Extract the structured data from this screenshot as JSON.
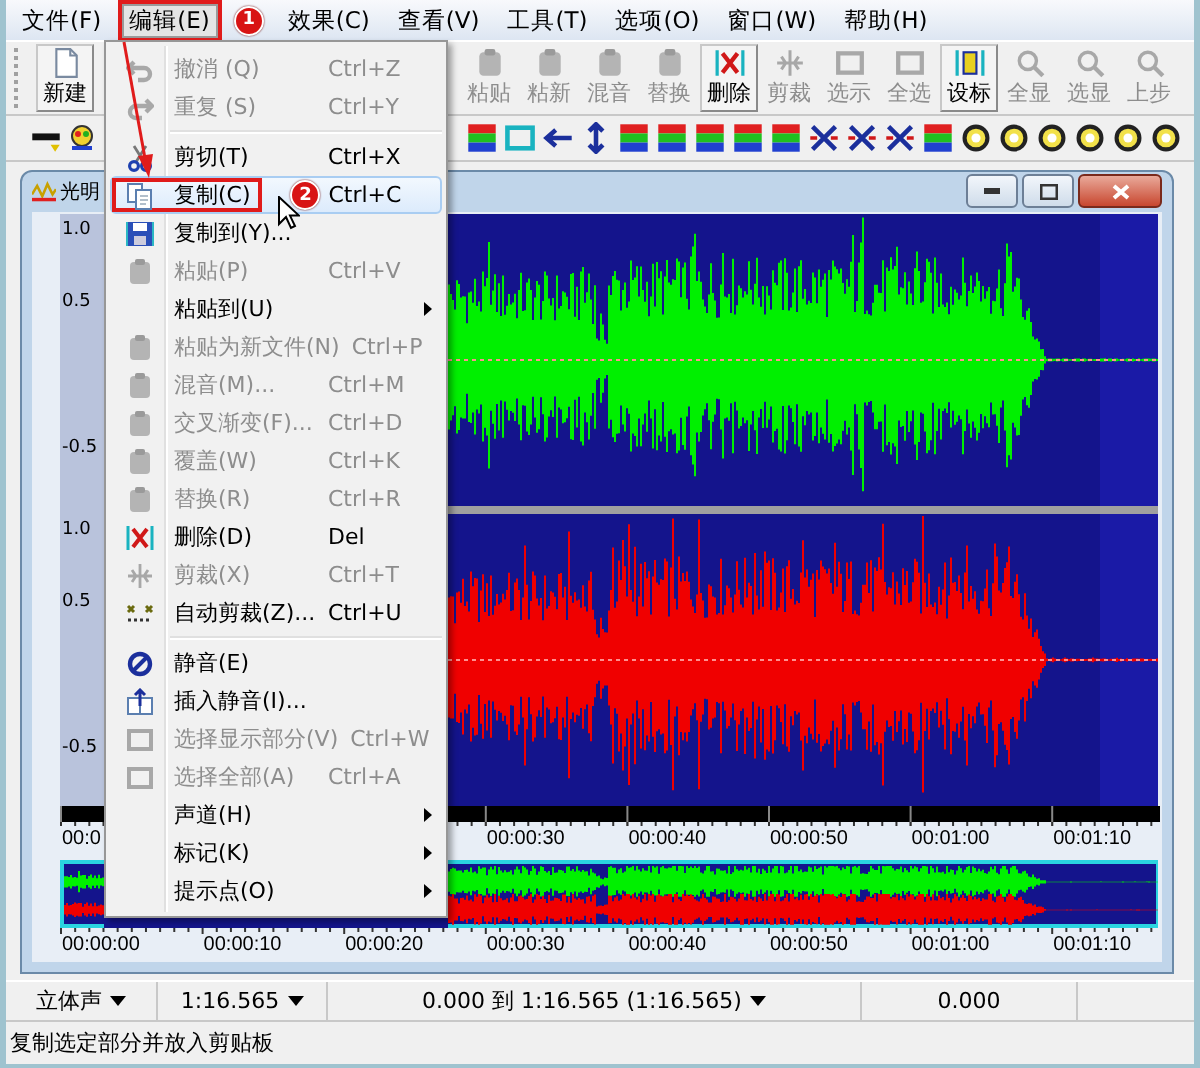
{
  "menu_bar": [
    {
      "label": "文件(F)",
      "selected": false
    },
    {
      "label": "编辑(E)",
      "selected": true,
      "callout": "1"
    },
    {
      "label": "效果(C)",
      "selected": false
    },
    {
      "label": "查看(V)",
      "selected": false
    },
    {
      "label": "工具(T)",
      "selected": false
    },
    {
      "label": "选项(O)",
      "selected": false
    },
    {
      "label": "窗口(W)",
      "selected": false
    },
    {
      "label": "帮助(H)",
      "selected": false
    }
  ],
  "toolbar": [
    {
      "label": "新建",
      "disabled": false
    },
    {
      "label": "粘贴",
      "disabled": true
    },
    {
      "label": "粘新",
      "disabled": true
    },
    {
      "label": "混音",
      "disabled": true
    },
    {
      "label": "替换",
      "disabled": true
    },
    {
      "label": "删除",
      "disabled": false
    },
    {
      "label": "剪裁",
      "disabled": true
    },
    {
      "label": "选示",
      "disabled": true
    },
    {
      "label": "全选",
      "disabled": true
    },
    {
      "label": "设标",
      "disabled": false
    },
    {
      "label": "全显",
      "disabled": true
    },
    {
      "label": "选显",
      "disabled": true
    },
    {
      "label": "上步",
      "disabled": true
    }
  ],
  "edit_menu": {
    "items": [
      {
        "kind": "item",
        "label": "撤消 (Q)",
        "shortcut": "Ctrl+Z",
        "disabled": true,
        "selected": false,
        "submenu": false
      },
      {
        "kind": "item",
        "label": "重复 (S)",
        "shortcut": "Ctrl+Y",
        "disabled": true,
        "selected": false,
        "submenu": false
      },
      {
        "kind": "separator"
      },
      {
        "kind": "item",
        "label": "剪切(T)",
        "shortcut": "Ctrl+X",
        "disabled": false,
        "selected": false,
        "submenu": false
      },
      {
        "kind": "item",
        "label": "复制(C)",
        "shortcut": "Ctrl+C",
        "disabled": false,
        "selected": true,
        "submenu": false,
        "callout": "2"
      },
      {
        "kind": "item",
        "label": "复制到(Y)...",
        "disabled": false,
        "selected": false,
        "submenu": false
      },
      {
        "kind": "item",
        "label": "粘贴(P)",
        "shortcut": "Ctrl+V",
        "disabled": true,
        "selected": false,
        "submenu": false
      },
      {
        "kind": "item",
        "label": "粘贴到(U)",
        "disabled": false,
        "selected": false,
        "submenu": true
      },
      {
        "kind": "item",
        "label": "粘贴为新文件(N)",
        "shortcut": "Ctrl+P",
        "disabled": true,
        "selected": false,
        "submenu": false
      },
      {
        "kind": "item",
        "label": "混音(M)...",
        "shortcut": "Ctrl+M",
        "disabled": true,
        "selected": false,
        "submenu": false
      },
      {
        "kind": "item",
        "label": "交叉渐变(F)...",
        "shortcut": "Ctrl+D",
        "disabled": true,
        "selected": false,
        "submenu": false
      },
      {
        "kind": "item",
        "label": "覆盖(W)",
        "shortcut": "Ctrl+K",
        "disabled": true,
        "selected": false,
        "submenu": false
      },
      {
        "kind": "item",
        "label": "替换(R)",
        "shortcut": "Ctrl+R",
        "disabled": true,
        "selected": false,
        "submenu": false
      },
      {
        "kind": "item",
        "label": "删除(D)",
        "shortcut": "Del",
        "disabled": false,
        "selected": false,
        "submenu": false
      },
      {
        "kind": "item",
        "label": "剪裁(X)",
        "shortcut": "Ctrl+T",
        "disabled": true,
        "selected": false,
        "submenu": false
      },
      {
        "kind": "item",
        "label": "自动剪裁(Z)...",
        "shortcut": "Ctrl+U",
        "disabled": false,
        "selected": false,
        "submenu": false
      },
      {
        "kind": "separator"
      },
      {
        "kind": "item",
        "label": "静音(E)",
        "disabled": false,
        "selected": false,
        "submenu": false
      },
      {
        "kind": "item",
        "label": "插入静音(I)...",
        "disabled": false,
        "selected": false,
        "submenu": false
      },
      {
        "kind": "item",
        "label": "选择显示部分(V)",
        "shortcut": "Ctrl+W",
        "disabled": true,
        "selected": false,
        "submenu": false
      },
      {
        "kind": "item",
        "label": "选择全部(A)",
        "shortcut": "Ctrl+A",
        "disabled": true,
        "selected": false,
        "submenu": false
      },
      {
        "kind": "item",
        "label": "声道(H)",
        "disabled": false,
        "selected": false,
        "submenu": true
      },
      {
        "kind": "item",
        "label": "标记(K)",
        "disabled": false,
        "selected": false,
        "submenu": true
      },
      {
        "kind": "item",
        "label": "提示点(O)",
        "disabled": false,
        "selected": false,
        "submenu": true
      }
    ]
  },
  "document_window": {
    "title": "光明",
    "channels": [
      {
        "axis_labels": [
          "1.0",
          "0.5",
          "-0.5"
        ]
      },
      {
        "axis_labels": [
          "1.0",
          "0.5",
          "-0.5"
        ]
      }
    ],
    "ruler_labels": [
      "00:0",
      "00:00:30",
      "00:00:40",
      "00:00:50",
      "00:01:00",
      "00:01:10"
    ],
    "overview_ruler_labels": [
      "00:00:00",
      "00:00:10",
      "00:00:20",
      "00:00:30",
      "00:00:40",
      "00:00:50",
      "00:01:00",
      "00:01:10"
    ]
  },
  "status_bar": {
    "fields": [
      {
        "text": "立体声",
        "dropdown": true
      },
      {
        "text": "1:16.565",
        "dropdown": true
      },
      {
        "text": "0.000 到 1:16.565 (1:16.565)",
        "dropdown": true
      },
      {
        "text": "0.000",
        "dropdown": false
      }
    ],
    "message": "复制选定部分并放入剪贴板"
  }
}
